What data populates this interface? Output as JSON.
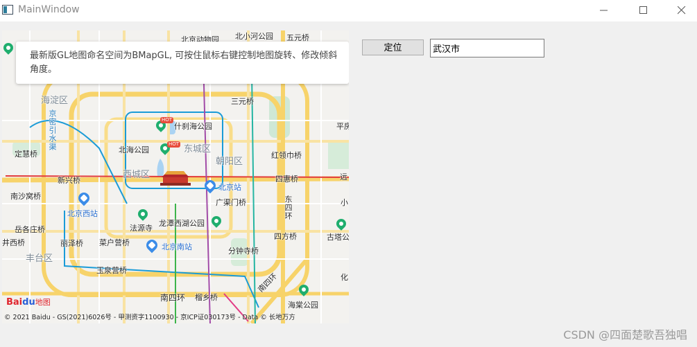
{
  "window": {
    "title": "MainWindow",
    "icon": "app-window-icon"
  },
  "controls": {
    "minimize": "minimize-icon",
    "maximize": "maximize-icon",
    "close": "close-icon"
  },
  "map": {
    "notice": "最新版GL地图命名空间为BMapGL, 可按住鼠标右键控制地图旋转、修改倾斜角度。",
    "logo": {
      "en": "Bai",
      "paw": "du",
      "cn": "地图"
    },
    "copyright": "© 2021 Baidu - GS(2021)6026号 - 甲测资字1100930 - 京ICP证030173号 - Data © 长地万方",
    "labels": {
      "top_a": "北京动物园",
      "top_b": "北小河公园",
      "top_c": "五元桥",
      "haidian": "海淀区",
      "jingmi": "京密引水渠",
      "sanyuan": "三元桥",
      "shichahai": "什刹海公园",
      "dongcheng": "东城区",
      "beihai": "北海公园",
      "chaoyang": "朝阳区",
      "dinghui": "定慧桥",
      "hongling": "红领巾桥",
      "xicheng": "西城区",
      "sihui": "四惠桥",
      "xinxing": "新兴桥",
      "beijingzhan": "北京站",
      "nanshagou": "南沙窝桥",
      "guangqumen": "广渠门桥",
      "beijingxi": "北京西站",
      "dongsihuan": "东四环",
      "yuegezhuang": "岳各庄桥",
      "fayuan": "法源寺",
      "longtanxihu": "龙潭西湖公园",
      "liuquan": "六里桥",
      "jingxi": "井西桥",
      "lize": "丽泽桥",
      "caihuying": "菜户营桥",
      "beijingnan": "北京南站",
      "fenzhong": "分钟寺桥",
      "sifang": "四方桥",
      "fengtai": "丰台区",
      "yuquanying": "玉泉营桥",
      "nansihuan": "南四环",
      "liuxiang": "榴乡桥",
      "nansihuan_e": "南四环",
      "haitang": "海棠公园",
      "ping": "平房",
      "yuan": "远",
      "xiao": "小",
      "gutaw": "古塔公",
      "hua": "化"
    }
  },
  "toolbar": {
    "locate_label": "定位",
    "city_value": "武汉市"
  },
  "watermark": "CSDN @四面楚歌吾独唱"
}
